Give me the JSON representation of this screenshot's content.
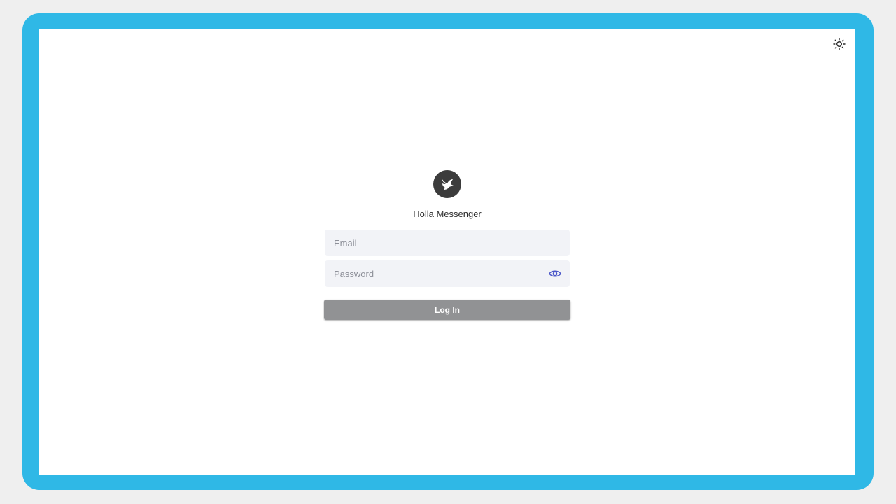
{
  "app": {
    "name": "Holla Messenger",
    "logo_icon": "bird-icon"
  },
  "header": {
    "theme_toggle_icon": "sun-icon"
  },
  "form": {
    "email": {
      "placeholder": "Email",
      "value": ""
    },
    "password": {
      "placeholder": "Password",
      "value": "",
      "visibility_icon": "eye-icon"
    },
    "submit_label": "Log In"
  },
  "colors": {
    "frame": "#2fb8e6",
    "button": "#919294",
    "eye_icon": "#4a56c8",
    "logo_bg": "#3c3c3c"
  }
}
